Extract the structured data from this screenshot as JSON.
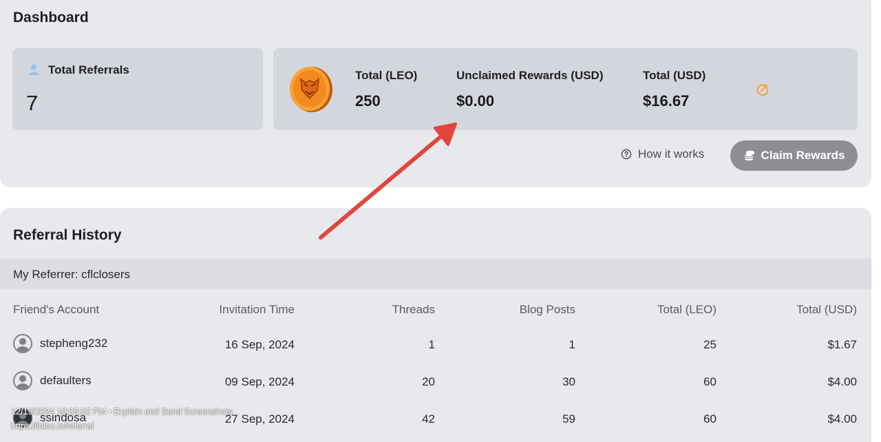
{
  "dashboard": {
    "title": "Dashboard",
    "referrals": {
      "label": "Total Referrals",
      "count": "7"
    },
    "rewards": {
      "total_leo_label": "Total (LEO)",
      "total_leo_value": "250",
      "unclaimed_label": "Unclaimed Rewards (USD)",
      "unclaimed_value": "$0.00",
      "total_usd_label": "Total (USD)",
      "total_usd_value": "$16.67"
    },
    "how_it_works": "How it works",
    "claim_button": "Claim Rewards"
  },
  "history": {
    "title": "Referral History",
    "referrer": "My Referrer: cflclosers",
    "columns": [
      "Friend's Account",
      "Invitation Time",
      "Threads",
      "Blog Posts",
      "Total (LEO)",
      "Total (USD)"
    ],
    "rows": [
      {
        "account": "stepheng232",
        "invited": "16 Sep, 2024",
        "threads": "1",
        "blog_posts": "1",
        "total_leo": "25",
        "total_usd": "$1.67"
      },
      {
        "account": "defaulters",
        "invited": "09 Sep, 2024",
        "threads": "20",
        "blog_posts": "30",
        "total_leo": "60",
        "total_usd": "$4.00"
      },
      {
        "account": "ssindosa",
        "invited": "27 Sep, 2024",
        "threads": "42",
        "blog_posts": "59",
        "total_leo": "60",
        "total_usd": "$4.00"
      }
    ]
  },
  "watermark": {
    "line1": "12/19/2024 10:06:02 PM • Explain and Send Screenshots",
    "line2": "https://inleo.io/referral"
  },
  "colors": {
    "card_bg": "#e8e9ed",
    "stat_bg": "#d4d6de",
    "coin_orange": "#f28a1f",
    "claim_button_bg": "#8d8e93",
    "annotation_arrow": "#e1453c"
  },
  "icons": {
    "referrals": "user-icon",
    "coin": "leo-coin-icon",
    "refresh": "refresh-icon",
    "help": "question-circle-icon",
    "claim": "coins-stack-icon",
    "avatar": "default-avatar-icon"
  }
}
